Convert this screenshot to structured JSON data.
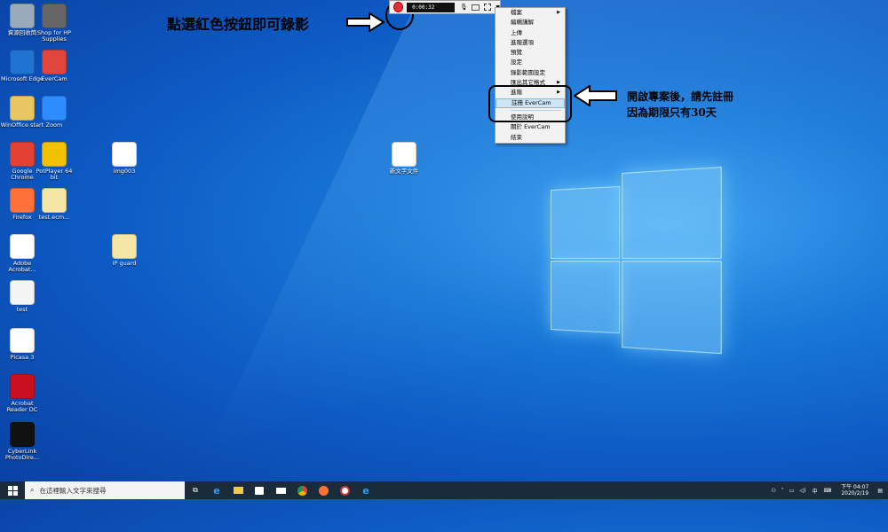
{
  "desktop_icons": [
    {
      "label": "資源回收筒",
      "icon": "recycle-bin-icon",
      "color": "#9ab"
    },
    {
      "label": "Shop for HP Supplies",
      "icon": "printer-icon",
      "color": "#666"
    },
    {
      "label": "Microsoft Edge",
      "icon": "edge-icon",
      "color": "#1f74d1"
    },
    {
      "label": "EverCam",
      "icon": "evercam-icon",
      "color": "#e2453c"
    },
    {
      "label": "WinOffice start",
      "icon": "folder-icon",
      "color": "#e8c660"
    },
    {
      "label": "Zoom",
      "icon": "zoom-icon",
      "color": "#2d8cff"
    },
    {
      "label": "Google Chrome",
      "icon": "chrome-icon",
      "color": "#e34133"
    },
    {
      "label": "PotPlayer 64 bit",
      "icon": "potplayer-icon",
      "color": "#f2c200"
    },
    {
      "label": "img003",
      "icon": "pdf-icon",
      "color": "#fff"
    },
    {
      "label": "新文字文件",
      "icon": "text-file-icon",
      "color": "#fff"
    },
    {
      "label": "Firefox",
      "icon": "firefox-icon",
      "color": "#ff7139"
    },
    {
      "label": "test.ecm...",
      "icon": "file-icon",
      "color": "#f5e6a6"
    },
    {
      "label": "Adobe Acrobat...",
      "icon": "acrobat-file-icon",
      "color": "#fff"
    },
    {
      "label": "IP guard",
      "icon": "archive-icon",
      "color": "#f5e6a6"
    },
    {
      "label": "test",
      "icon": "test-app-icon",
      "color": "#f4f4f4"
    },
    {
      "label": "Picasa 3",
      "icon": "picasa-icon",
      "color": "#fff"
    },
    {
      "label": "Acrobat Reader DC",
      "icon": "acrobat-reader-icon",
      "color": "#c8101f"
    },
    {
      "label": "CyberLink PhotoDire...",
      "icon": "photodirector-icon",
      "color": "#111"
    }
  ],
  "annotations": {
    "top": "點選紅色按鈕即可錄影",
    "side_line1": "開啟專案後，請先註冊",
    "side_line2": "因為期限只有30天"
  },
  "recorder": {
    "timer": "0:00:32"
  },
  "context_menu": {
    "items": [
      {
        "label": "檔案",
        "submenu": true
      },
      {
        "label": "編輯講解",
        "submenu": false
      },
      {
        "label": "上傳",
        "submenu": false
      },
      {
        "label": "進階選項",
        "submenu": false
      },
      {
        "label": "預覽",
        "submenu": false
      },
      {
        "label": "設定",
        "submenu": false
      },
      {
        "label": "錄影範圍設定",
        "submenu": false
      },
      {
        "label": "匯出其它格式",
        "submenu": true
      },
      {
        "label": "進階",
        "submenu": true
      },
      {
        "label": "註冊 EverCam",
        "submenu": false,
        "selected": true
      },
      {
        "label": "使用說明",
        "submenu": false
      },
      {
        "label": "關於 EverCam",
        "submenu": false
      },
      {
        "label": "結束",
        "submenu": false
      }
    ]
  },
  "taskbar": {
    "search_placeholder": "在這裡輸入文字來搜尋",
    "ime": "中",
    "clock_time": "下午 04:07",
    "clock_date": "2020/2/19"
  },
  "colors": {
    "desktop_accent": "#1a78d8",
    "taskbar": "#1c2b3a",
    "record_button": "#e0303a"
  }
}
